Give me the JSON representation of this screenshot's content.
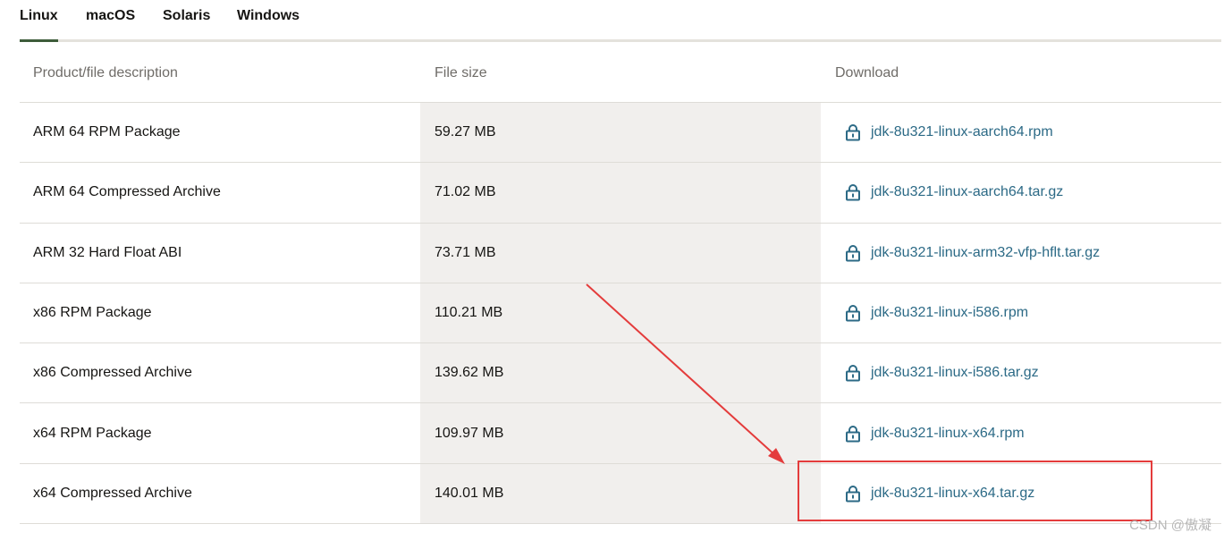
{
  "tabs": [
    {
      "label": "Linux",
      "active": true
    },
    {
      "label": "macOS",
      "active": false
    },
    {
      "label": "Solaris",
      "active": false
    },
    {
      "label": "Windows",
      "active": false
    }
  ],
  "table": {
    "headers": {
      "description": "Product/file description",
      "size": "File size",
      "download": "Download"
    },
    "rows": [
      {
        "description": "ARM 64 RPM Package",
        "size": "59.27 MB",
        "file": "jdk-8u321-linux-aarch64.rpm"
      },
      {
        "description": "ARM 64 Compressed Archive",
        "size": "71.02 MB",
        "file": "jdk-8u321-linux-aarch64.tar.gz"
      },
      {
        "description": "ARM 32 Hard Float ABI",
        "size": "73.71 MB",
        "file": "jdk-8u321-linux-arm32-vfp-hflt.tar.gz"
      },
      {
        "description": "x86 RPM Package",
        "size": "110.21 MB",
        "file": "jdk-8u321-linux-i586.rpm"
      },
      {
        "description": "x86 Compressed Archive",
        "size": "139.62 MB",
        "file": "jdk-8u321-linux-i586.tar.gz"
      },
      {
        "description": "x64 RPM Package",
        "size": "109.97 MB",
        "file": "jdk-8u321-linux-x64.rpm"
      },
      {
        "description": "x64 Compressed Archive",
        "size": "140.01 MB",
        "file": "jdk-8u321-linux-x64.tar.gz"
      }
    ]
  },
  "icons": {
    "download": "lock-icon"
  },
  "colors": {
    "link": "#2c6a86",
    "annotation": "#e43c3c",
    "size_column_bg": "#f1efed",
    "active_tab_underline": "#3d5c3a"
  },
  "watermark": "CSDN @傲凝"
}
